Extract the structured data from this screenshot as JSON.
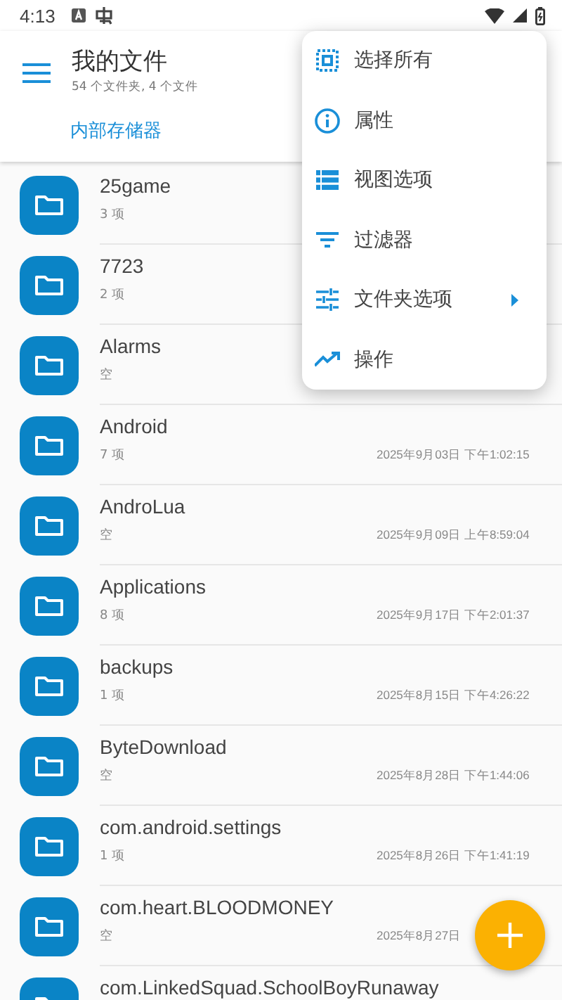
{
  "status_bar": {
    "time": "4:13"
  },
  "app_bar": {
    "title": "我的文件",
    "subtitle": "54 个文件夹, 4 个文件",
    "breadcrumb": "内部存储器"
  },
  "files": [
    {
      "name": "25game",
      "info": "3 项"
    },
    {
      "name": "7723",
      "info": "2 项"
    },
    {
      "name": "Alarms",
      "info": "空"
    },
    {
      "name": "Android",
      "info": "7 项",
      "date": "2025年9月03日 下午1:02:15"
    },
    {
      "name": "AndroLua",
      "info": "空",
      "date": "2025年9月09日 上午8:59:04"
    },
    {
      "name": "Applications",
      "info": "8 项",
      "date": "2025年9月17日 下午2:01:37"
    },
    {
      "name": "backups",
      "info": "1 项",
      "date": "2025年8月15日 下午4:26:22"
    },
    {
      "name": "ByteDownload",
      "info": "空",
      "date": "2025年8月28日 下午1:44:06"
    },
    {
      "name": "com.android.settings",
      "info": "1 项",
      "date": "2025年8月26日 下午1:41:19"
    },
    {
      "name": "com.heart.BLOODMONEY",
      "info": "空",
      "date": "2025年8月27日"
    },
    {
      "name": "com.LinkedSquad.SchoolBoyRunaway"
    }
  ],
  "menu": [
    {
      "kind": "select",
      "label": "选择所有",
      "submenu": false
    },
    {
      "kind": "info",
      "label": "属性",
      "submenu": false
    },
    {
      "kind": "view",
      "label": "视图选项",
      "submenu": false
    },
    {
      "kind": "filter",
      "label": "过滤器",
      "submenu": false
    },
    {
      "kind": "tune",
      "label": "文件夹选项",
      "submenu": true
    },
    {
      "kind": "trend",
      "label": "操作",
      "submenu": false
    }
  ]
}
